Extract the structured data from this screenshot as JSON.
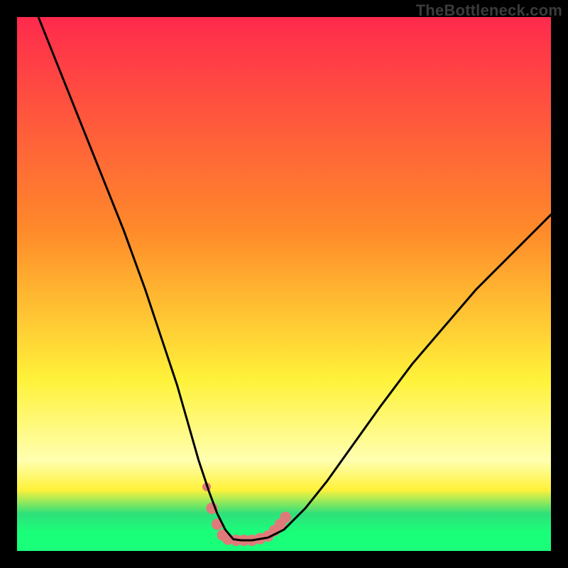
{
  "watermark": "TheBottleneck.com",
  "colors": {
    "top": "#ff2a4d",
    "mid_orange": "#ff8a2a",
    "yellow": "#fff23a",
    "pale_yellow": "#ffffb0",
    "green": "#2fe07a",
    "green_bright": "#1aff7a",
    "curve": "#000000",
    "marker": "#e07a7a",
    "frame": "#000000"
  },
  "chart_data": {
    "type": "line",
    "title": "",
    "xlabel": "",
    "ylabel": "",
    "xlim": [
      0,
      100
    ],
    "ylim": [
      0,
      100
    ],
    "series": [
      {
        "name": "bottleneck-curve",
        "x": [
          4,
          8,
          12,
          16,
          20,
          24,
          27,
          30,
          32,
          34,
          36,
          37.5,
          39,
          40.5,
          42,
          44,
          47,
          50,
          54,
          58,
          63,
          68,
          74,
          80,
          86,
          92,
          98,
          100
        ],
        "y": [
          100,
          90,
          80,
          70,
          60,
          49,
          40,
          31,
          24,
          17,
          11,
          7,
          4,
          2.2,
          2,
          2,
          2.5,
          4,
          8,
          13,
          20,
          27,
          35,
          42,
          49,
          55,
          61,
          63
        ]
      }
    ],
    "markers": {
      "name": "highlight-dots",
      "color": "#e07a7a",
      "points": [
        {
          "x": 35.5,
          "y": 12,
          "r": 6
        },
        {
          "x": 36.5,
          "y": 8,
          "r": 8
        },
        {
          "x": 37.5,
          "y": 5,
          "r": 8
        },
        {
          "x": 38.5,
          "y": 3,
          "r": 8
        },
        {
          "x": 39.5,
          "y": 2.2,
          "r": 8
        },
        {
          "x": 41,
          "y": 2,
          "r": 8
        },
        {
          "x": 42.5,
          "y": 2,
          "r": 8
        },
        {
          "x": 44,
          "y": 2,
          "r": 8
        },
        {
          "x": 45.5,
          "y": 2.3,
          "r": 8
        },
        {
          "x": 47,
          "y": 2.8,
          "r": 8
        },
        {
          "x": 48.2,
          "y": 3.8,
          "r": 8
        },
        {
          "x": 49.3,
          "y": 5,
          "r": 8
        },
        {
          "x": 50.3,
          "y": 6.3,
          "r": 8
        }
      ]
    },
    "gradient_stops": [
      {
        "offset": 0.0,
        "key": "top"
      },
      {
        "offset": 0.4,
        "key": "mid_orange"
      },
      {
        "offset": 0.68,
        "key": "yellow"
      },
      {
        "offset": 0.83,
        "key": "pale_yellow"
      },
      {
        "offset": 0.885,
        "key": "yellow"
      },
      {
        "offset": 0.93,
        "key": "green"
      },
      {
        "offset": 0.965,
        "key": "green_bright"
      },
      {
        "offset": 1.0,
        "key": "green_bright"
      }
    ]
  }
}
